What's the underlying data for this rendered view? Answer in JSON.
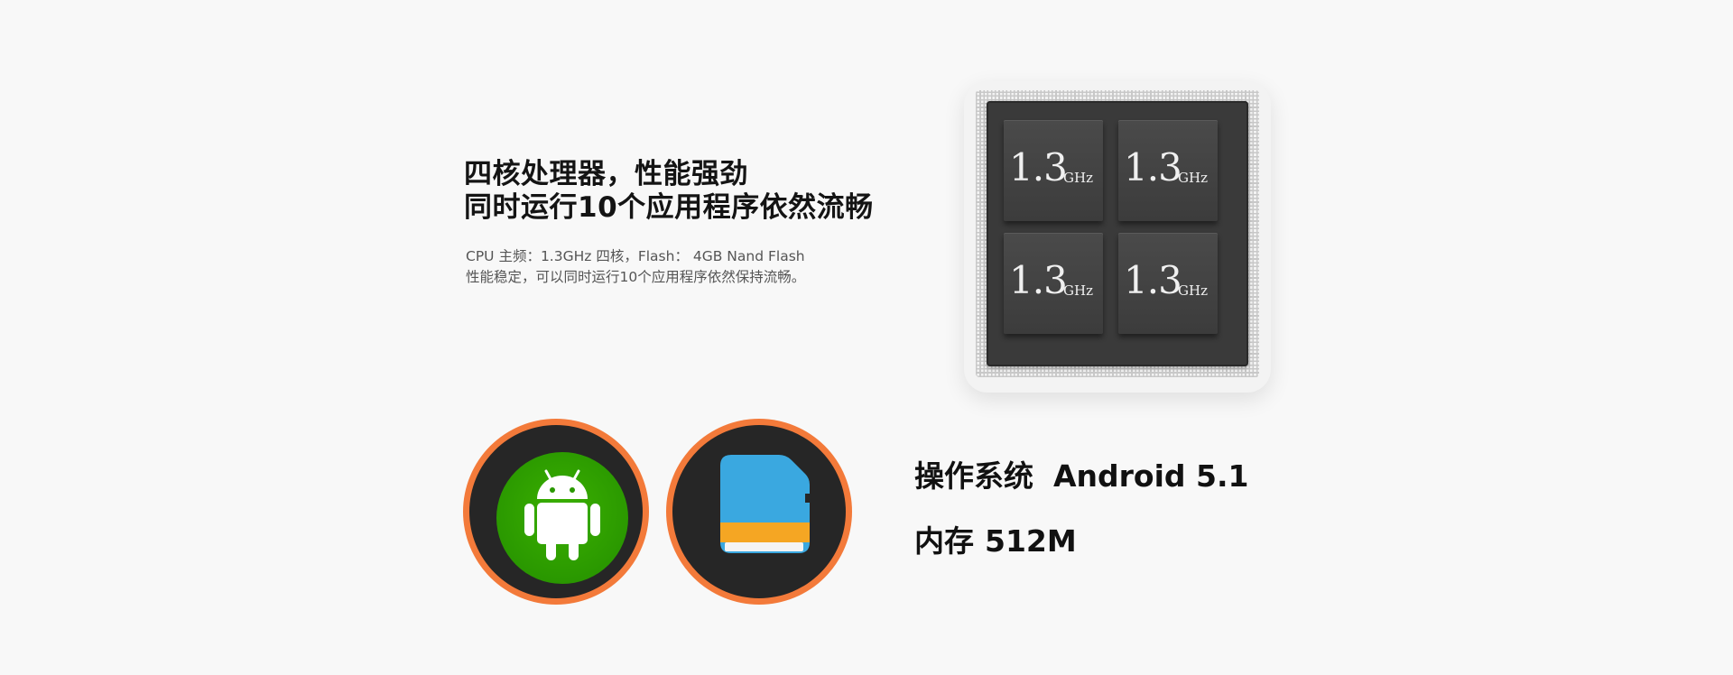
{
  "headline": {
    "line1": "四核处理器，性能强劲",
    "line2": "同时运行10个应用程序依然流畅"
  },
  "subtext": {
    "line1": "CPU 主频：1.3GHz 四核，Flash： 4GB Nand Flash",
    "line2": "性能稳定，可以同时运行10个应用程序依然保持流畅。"
  },
  "chip": {
    "cores": [
      {
        "value": "1.3",
        "unit": "GHz"
      },
      {
        "value": "1.3",
        "unit": "GHz"
      },
      {
        "value": "1.3",
        "unit": "GHz"
      },
      {
        "value": "1.3",
        "unit": "GHz"
      }
    ]
  },
  "icons": {
    "android": "android-icon",
    "storage": "sd-card-icon"
  },
  "specs": {
    "os_label": "操作系统",
    "os_value": "Android 5.1",
    "ram_label": "内存",
    "ram_value": "512M"
  },
  "colors": {
    "ring": "#f37a3a",
    "android_green": "#2a9800",
    "sd_blue": "#3aa8e0",
    "sd_orange": "#f5a623"
  }
}
